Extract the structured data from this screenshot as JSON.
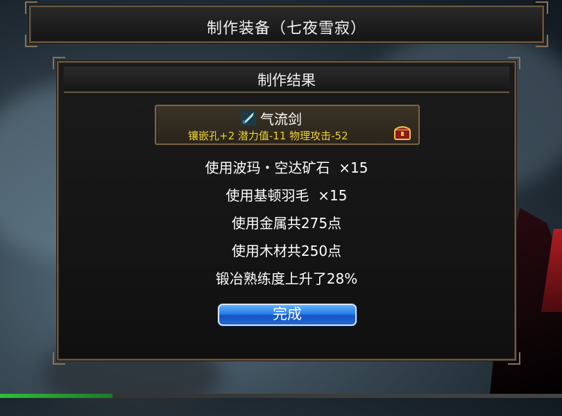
{
  "window": {
    "title": "制作装备（七夜雪寂）"
  },
  "result_panel": {
    "title": "制作结果",
    "item": {
      "name": "气流剑",
      "icon": "sword-icon",
      "stats": "镶嵌孔+2 潜力值-11 物理攻击-52",
      "badge_icon": "chest-icon",
      "stats_color": "#f0d232"
    },
    "lines": [
      "使用波玛・空达矿石  ×15",
      "使用基顿羽毛  ×15",
      "使用金属共275点",
      "使用木材共250点",
      "锻冶熟练度上升了28%"
    ],
    "done_button": "完成"
  }
}
